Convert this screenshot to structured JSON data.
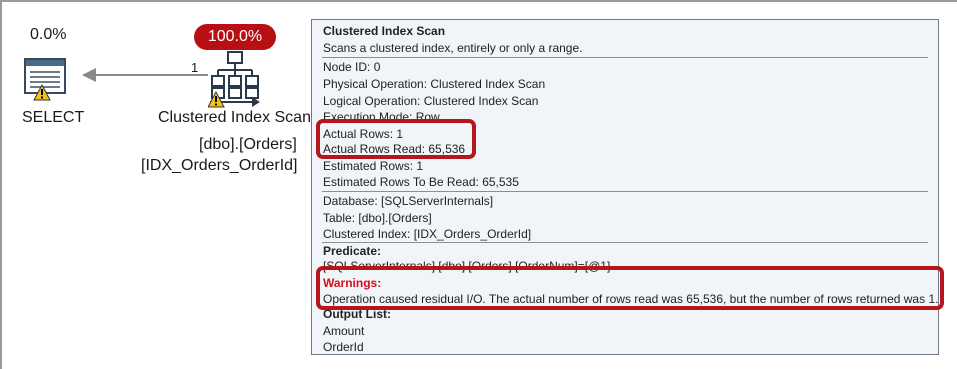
{
  "plan": {
    "select": {
      "cost": "0.0%",
      "label": "SELECT"
    },
    "arrow": {
      "row_count": "1"
    },
    "scan": {
      "cost": "100.0%",
      "label": "Clustered Index Scan",
      "table": "[dbo].[Orders]",
      "index": "[IDX_Orders_OrderId]"
    }
  },
  "tooltip": {
    "title": "Clustered Index Scan",
    "description": "Scans a clustered index, entirely or only a range.",
    "node_id": "Node ID:  0",
    "physical_op": "Physical Operation:  Clustered Index Scan",
    "logical_op": "Logical Operation:  Clustered Index Scan",
    "execution_mode": "Execution Mode:  Row",
    "actual_rows": "Actual Rows:  1",
    "actual_rows_read": "Actual Rows Read:  65,536",
    "estimated_rows": "Estimated Rows:  1",
    "estimated_rows_read": "Estimated Rows To Be Read:  65,535",
    "database": "Database:  [SQLServerInternals]",
    "table": "Table:  [dbo].[Orders]",
    "clustered_index": "Clustered Index:  [IDX_Orders_OrderId]",
    "predicate_heading": "Predicate:",
    "predicate_text": "[SQLServerInternals].[dbo].[Orders].[OrderNum]=[@1]",
    "warnings_heading": "Warnings:",
    "warnings_text": "Operation caused residual I/O. The actual number of rows read was 65,536, but the number of rows returned was 1.",
    "output_heading": "Output List:",
    "output_items": [
      "Amount",
      "OrderId"
    ]
  },
  "colors": {
    "highlight": "#b5161e",
    "cost_badge": "#b80f14",
    "warning_text": "#d4101b",
    "tooltip_bg": "#f1f4f8"
  }
}
